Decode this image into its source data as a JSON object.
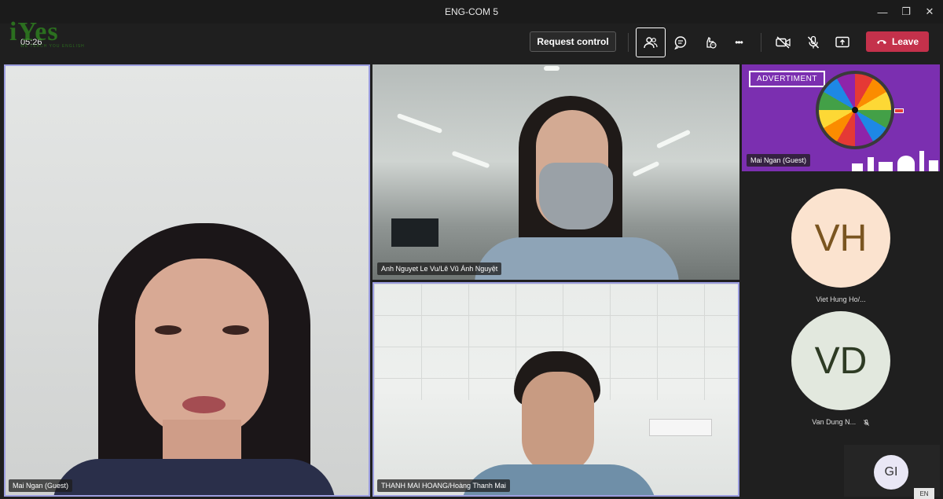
{
  "window": {
    "title": "ENG-COM 5",
    "minimize_glyph": "—",
    "maximize_glyph": "❐",
    "close_glyph": "✕"
  },
  "logo": {
    "text": "iYes",
    "sub": "WE TEACH YOU ENGLISH"
  },
  "toolbar": {
    "timer": "05:26",
    "request_control_label": "Request control",
    "leave_label": "Leave",
    "icons": [
      "people-icon",
      "chat-icon",
      "reactions-icon",
      "more-icon",
      "camera-off-icon",
      "mic-off-icon",
      "share-icon",
      "phone-icon"
    ],
    "more_glyph": "•••"
  },
  "tiles": {
    "main": {
      "name": "Mai Ngan (Guest)"
    },
    "factory": {
      "name": "Anh Nguyet Le Vu/Lê Vũ Ánh Nguyệt"
    },
    "office": {
      "name": "THANH MAI HOANG/Hoàng Thanh Mai"
    },
    "ad": {
      "label": "ADVERTIMENT",
      "name": "Mai Ngan (Guest)"
    }
  },
  "avatars": [
    {
      "initials": "VH",
      "name": "Viet Hung Ho/...",
      "bg": "#fbe3cf",
      "fg": "#7a5520"
    },
    {
      "initials": "VD",
      "name": "Van Dung N...",
      "bg": "#e2e8de",
      "fg": "#2e3b24"
    }
  ],
  "gi": {
    "initials": "GI"
  },
  "language": "EN",
  "colors": {
    "leave": "#c4314b",
    "tile_border": "#9c9ee0",
    "ad_bg": "#7b2fb0"
  }
}
